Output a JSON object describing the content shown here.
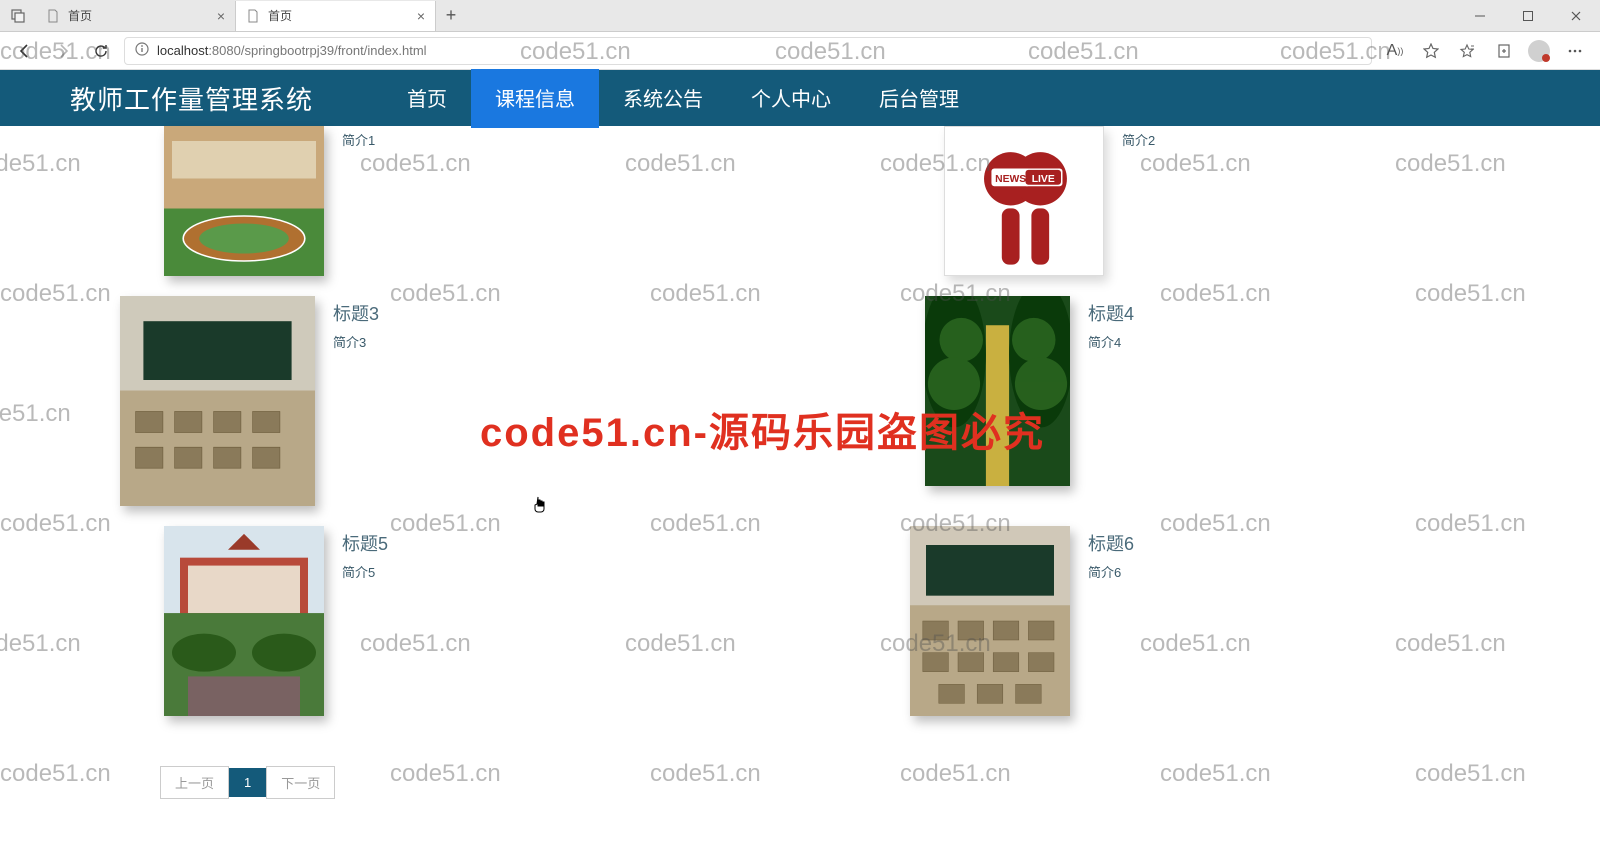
{
  "browser": {
    "tabs": [
      {
        "title": "首页",
        "active": false
      },
      {
        "title": "首页",
        "active": true
      }
    ],
    "url": "localhost:8080/springbootrpj39/front/index.html",
    "url_host": "localhost",
    "url_port": ":8080",
    "url_path": "/springbootrpj39/front/index.html"
  },
  "nav": {
    "site_title": "教师工作量管理系统",
    "items": [
      {
        "label": "首页",
        "state": ""
      },
      {
        "label": "课程信息",
        "state": "highlight"
      },
      {
        "label": "系统公告",
        "state": "underline"
      },
      {
        "label": "个人中心",
        "state": ""
      },
      {
        "label": "后台管理",
        "state": ""
      }
    ]
  },
  "cards": {
    "row1": [
      {
        "title": "",
        "sub": "简介1"
      },
      {
        "title": "",
        "sub": "简介2"
      }
    ],
    "list": [
      {
        "title": "标题3",
        "sub": "简介3"
      },
      {
        "title": "标题4",
        "sub": "简介4"
      },
      {
        "title": "标题5",
        "sub": "简介5"
      },
      {
        "title": "标题6",
        "sub": "简介6"
      }
    ]
  },
  "pager": {
    "prev": "上一页",
    "current": "1",
    "next": "下一页"
  },
  "watermark": {
    "text": "code51.cn",
    "center": "code51.cn-源码乐园盗图必究"
  }
}
